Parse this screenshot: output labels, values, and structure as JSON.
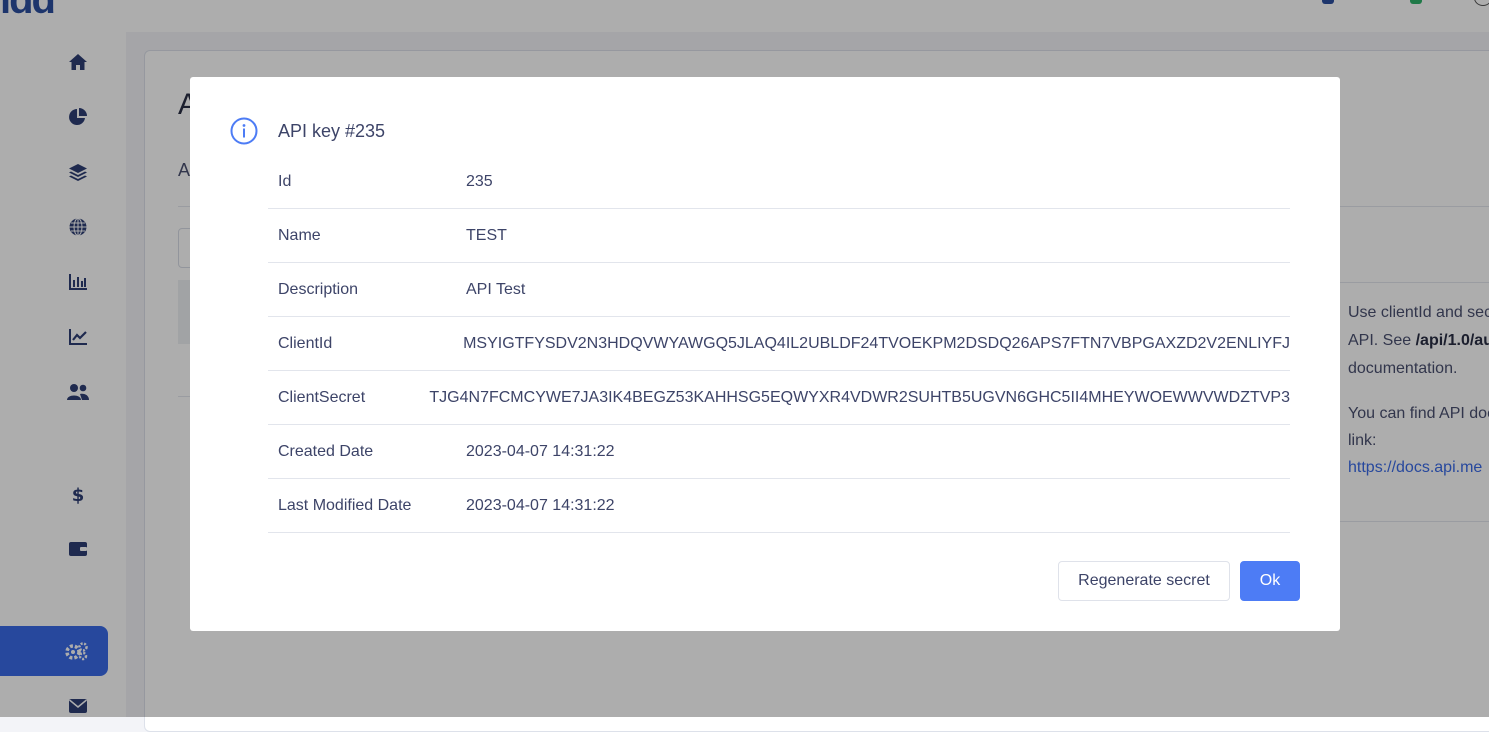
{
  "app": {
    "logo_text": "ıdd",
    "page_heading": "A",
    "page_subheading": "A"
  },
  "sidebar": {
    "items": [
      {
        "icon": "home-icon"
      },
      {
        "icon": "pie-chart-icon"
      },
      {
        "icon": "layers-icon"
      },
      {
        "icon": "globe-icon"
      },
      {
        "icon": "bar-chart-icon"
      },
      {
        "icon": "line-chart-icon"
      },
      {
        "icon": "users-icon"
      },
      {
        "icon": "dollar-icon"
      },
      {
        "icon": "wallet-icon"
      },
      {
        "icon": "cogs-icon",
        "active": true
      },
      {
        "icon": "envelope-icon"
      }
    ]
  },
  "info_panel": {
    "line1": "Use clientId and sec",
    "line2_prefix": "API. See ",
    "line2_bold": "/api/1.0/au",
    "line3": "documentation.",
    "line4": "You can find API doc",
    "line5": "link:",
    "link_text": "https://docs.api.me"
  },
  "modal": {
    "icon": "info-circle-icon",
    "title": "API key #235",
    "rows": [
      {
        "label": "Id",
        "value": "235"
      },
      {
        "label": "Name",
        "value": "TEST"
      },
      {
        "label": "Description",
        "value": "API Test"
      },
      {
        "label": "ClientId",
        "value": "MSYIGTFYSDV2N3HDQVWYAWGQ5JLAQ4IL2UBLDF24TVOEKPM2DSDQ26APS7FTN7VBPGAXZD2V2ENLIYFJ"
      },
      {
        "label": "ClientSecret",
        "value": "TJG4N7FCMCYWE7JA3IK4BEGZ53KAHHSG5EQWYXR4VDWR2SUHTB5UGVN6GHC5II4MHEYWOEWWVWDZTVP3"
      },
      {
        "label": "Created Date",
        "value": "2023-04-07 14:31:22"
      },
      {
        "label": "Last Modified Date",
        "value": "2023-04-07 14:31:22"
      }
    ],
    "buttons": {
      "regenerate": "Regenerate secret",
      "ok": "Ok"
    }
  },
  "colors": {
    "accent": "#4d7cf5",
    "sidebar_active": "#3a6be8",
    "text": "#3d4468"
  }
}
